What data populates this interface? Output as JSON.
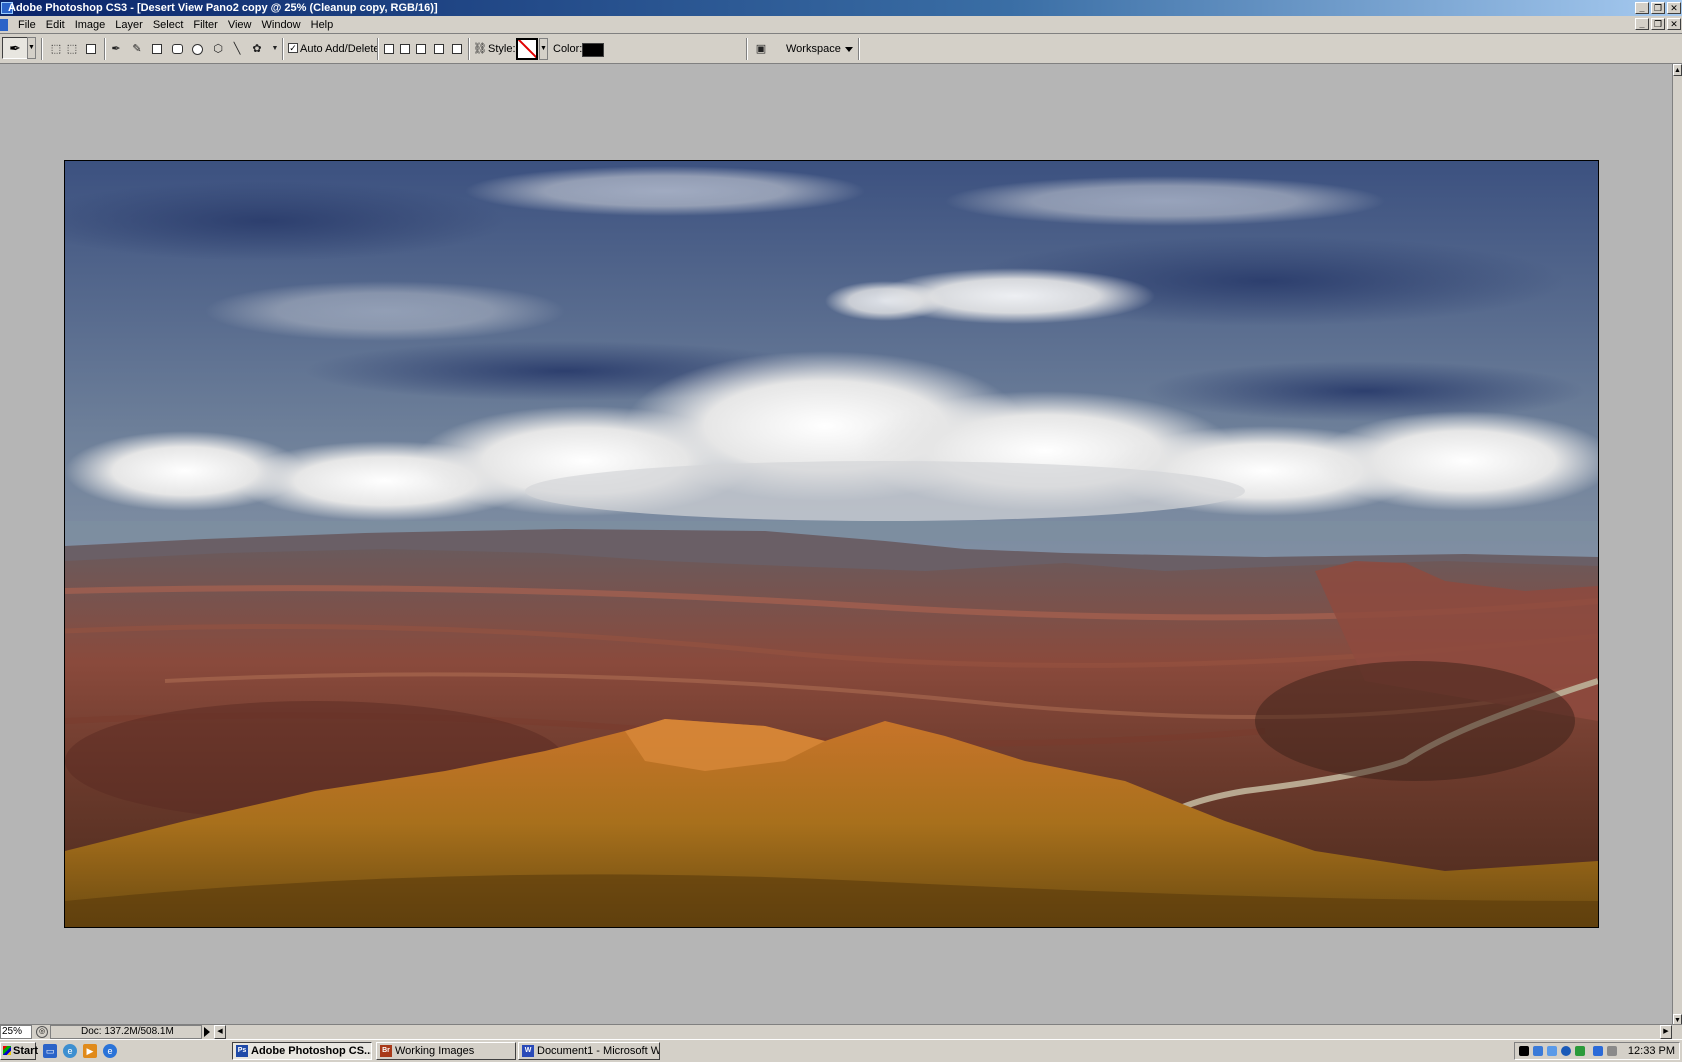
{
  "window": {
    "title": "Adobe Photoshop CS3 - [Desert View Pano2 copy @ 25% (Cleanup copy, RGB/16)]",
    "controls": [
      "_",
      "❐",
      "✕"
    ]
  },
  "menu": {
    "items": [
      "File",
      "Edit",
      "Image",
      "Layer",
      "Select",
      "Filter",
      "View",
      "Window",
      "Help"
    ]
  },
  "options_bar": {
    "auto_add_delete_label": "Auto Add/Delete",
    "auto_add_delete_checked": "✓",
    "style_label": "Style:",
    "color_label": "Color:",
    "color_value": "#000000",
    "workspace_label": "Workspace"
  },
  "status_bar": {
    "zoom": "25%",
    "doc_size": "Doc: 137.2M/508.1M"
  },
  "taskbar": {
    "start_label": "Start",
    "tasks": [
      {
        "label": "Adobe Photoshop CS...",
        "icon": "Ps",
        "active": true
      },
      {
        "label": "Working Images",
        "icon": "Br",
        "active": false
      },
      {
        "label": "Document1 - Microsoft W...",
        "icon": "W",
        "active": false
      }
    ],
    "clock": "12:33 PM"
  },
  "colors": {
    "titlebar_start": "#0a246a",
    "chrome": "#d4d0c8",
    "workspace_bg": "#b5b5b5"
  }
}
